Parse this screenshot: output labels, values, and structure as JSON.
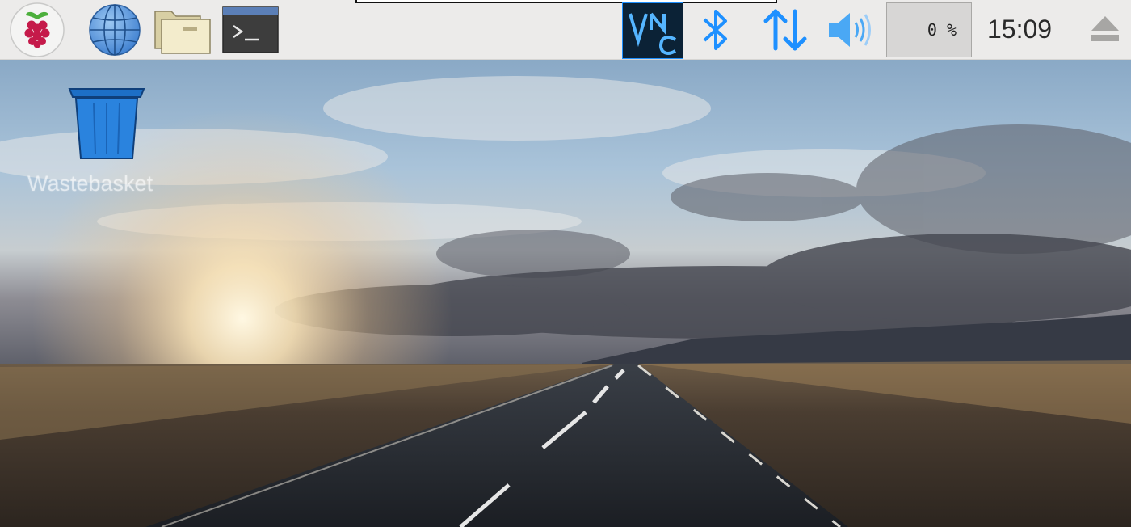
{
  "taskbar": {
    "launchers": [
      {
        "name": "menu",
        "icon": "raspberry-icon"
      },
      {
        "name": "browser",
        "icon": "globe-icon"
      },
      {
        "name": "file-manager",
        "icon": "folder-icon"
      },
      {
        "name": "terminal",
        "icon": "terminal-icon"
      }
    ],
    "tray": {
      "vnc_label": "VNC",
      "bluetooth_icon": "bluetooth-icon",
      "network_icon": "network-arrows-icon",
      "volume_icon": "volume-icon",
      "cpu_usage": "0 %",
      "clock": "15:09",
      "eject_icon": "eject-icon"
    },
    "colors": {
      "background": "#ecebea",
      "tray_blue": "#1e90ff",
      "vnc_background": "#0b2236"
    }
  },
  "desktop": {
    "icons": [
      {
        "label": "Wastebasket",
        "icon": "trash-icon"
      }
    ]
  }
}
